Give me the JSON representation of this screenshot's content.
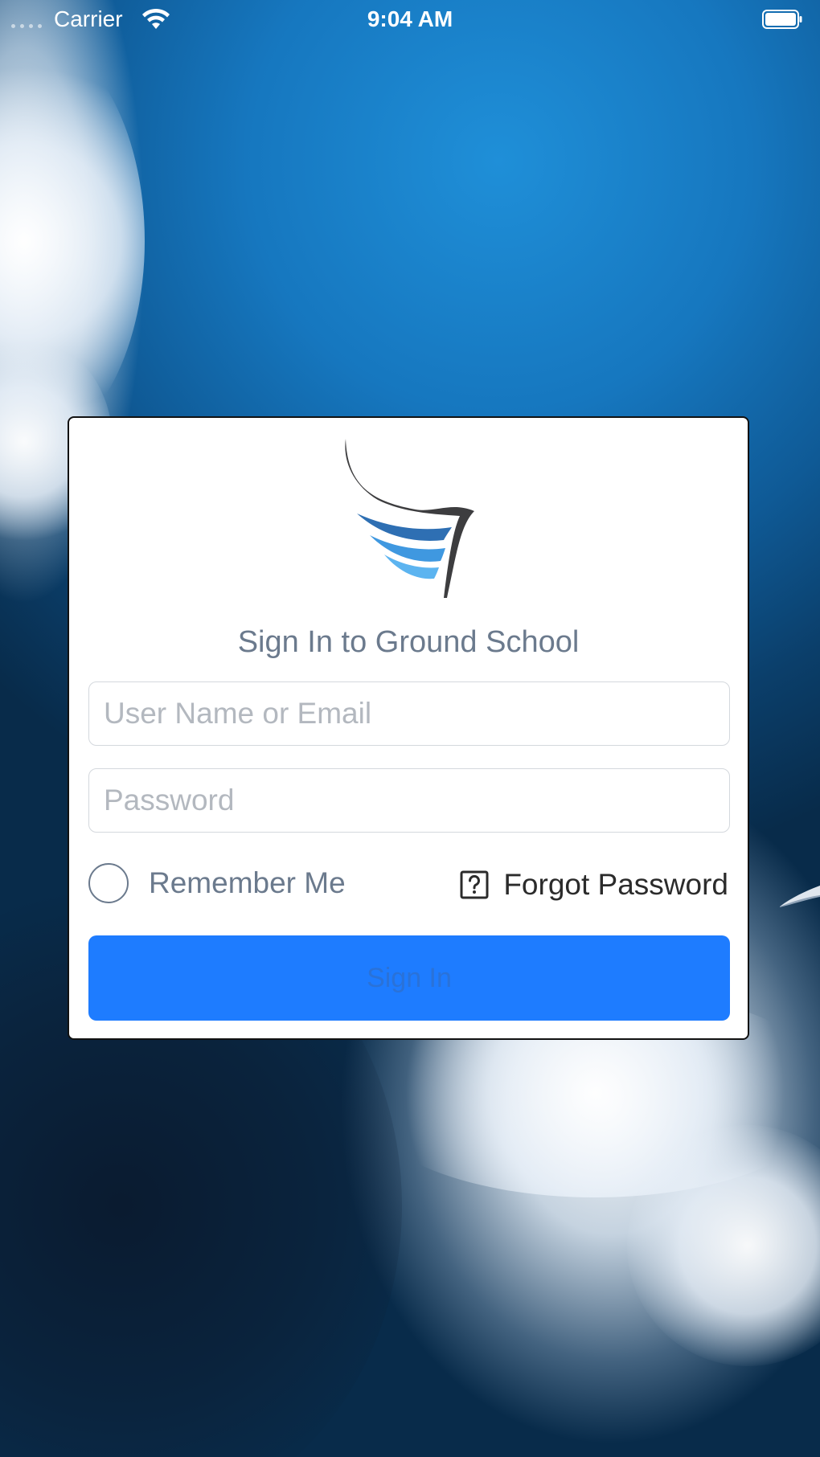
{
  "status_bar": {
    "carrier": "Carrier",
    "time": "9:04 AM"
  },
  "login": {
    "title": "Sign In to Ground School",
    "username_placeholder": "User Name or Email",
    "password_placeholder": "Password",
    "remember_label": "Remember Me",
    "remember_checked": false,
    "forgot_label": "Forgot Password",
    "signin_label": "Sign In"
  },
  "colors": {
    "accent": "#1e7cff",
    "label": "#6b7a8d",
    "logo_dark": "#3d3d3f",
    "logo_blue_1": "#2e6fb3",
    "logo_blue_2": "#3f98e0",
    "logo_blue_3": "#5cb4f0"
  },
  "icons": {
    "wifi": "wifi-icon",
    "battery": "battery-icon",
    "help": "question-box-icon",
    "logo": "wing-logo-icon"
  }
}
